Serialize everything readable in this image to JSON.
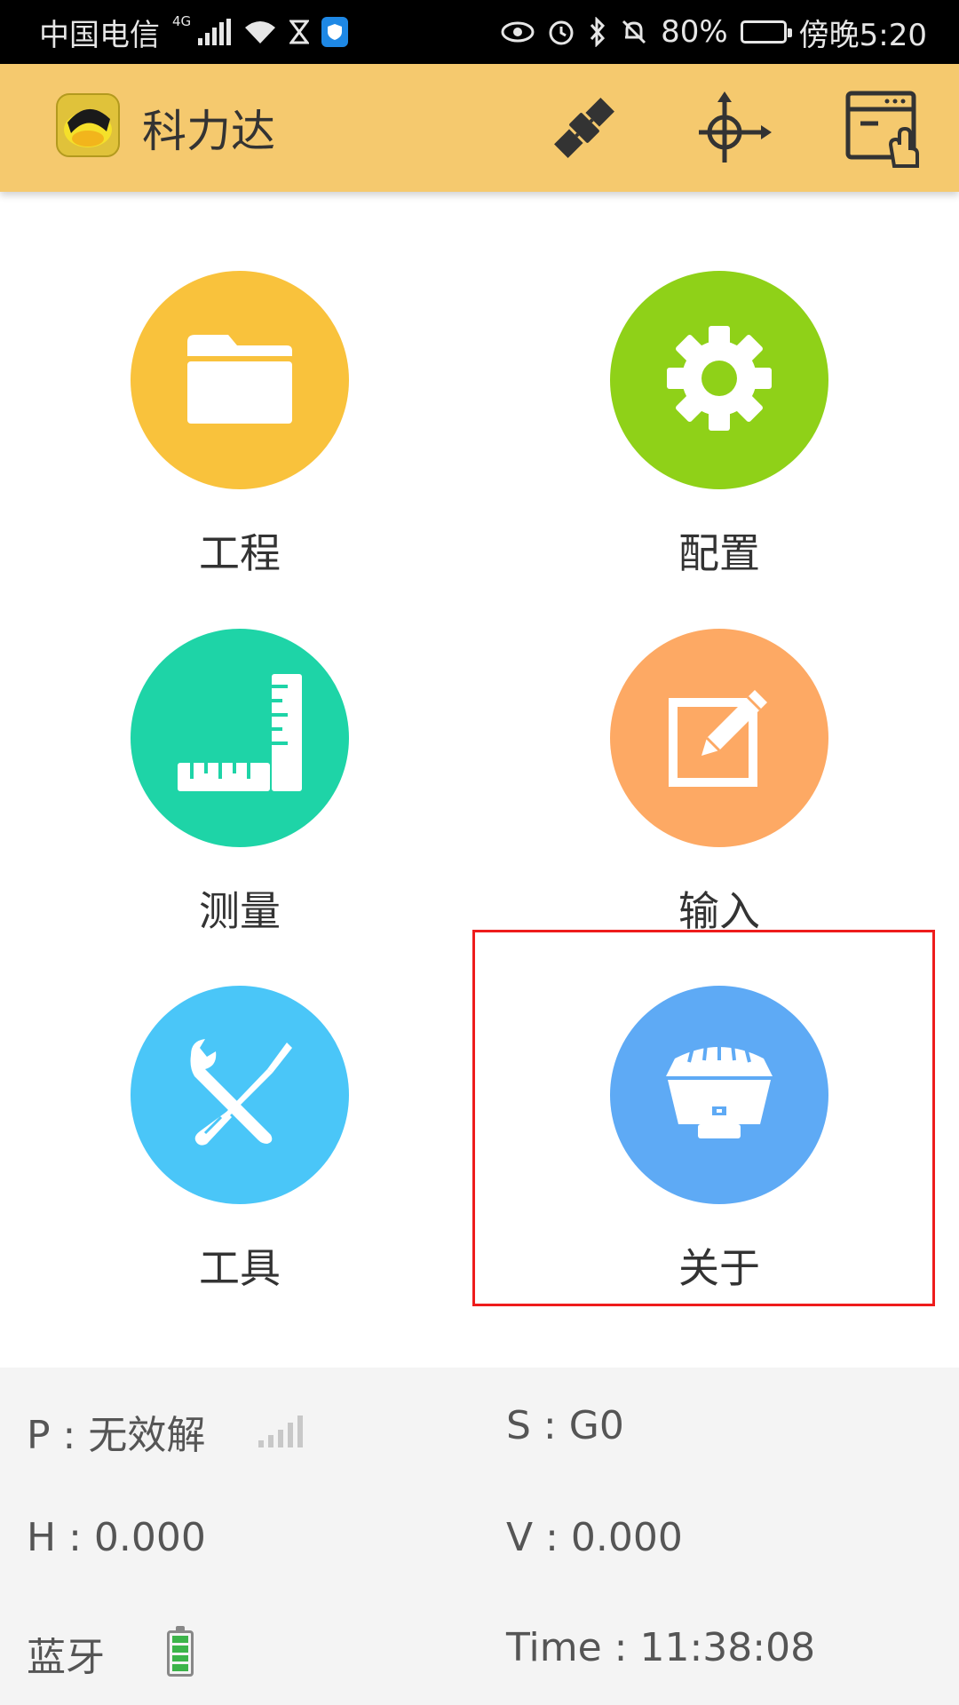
{
  "status_bar": {
    "carrier": "中国电信",
    "network": "4G",
    "battery_percent": "80%",
    "time": "傍晚5:20",
    "icons": [
      "signal-icon",
      "wifi-icon",
      "hourglass-icon",
      "shield-icon",
      "eye-icon",
      "alarm-icon",
      "bluetooth-icon",
      "mute-icon",
      "battery-icon"
    ]
  },
  "app_bar": {
    "title": "科力达",
    "actions": [
      "satellite-icon",
      "target-icon",
      "window-pointer-icon"
    ],
    "color": "#f5c96e"
  },
  "menu": {
    "items": [
      {
        "id": "project",
        "label": "工程",
        "icon": "folder-icon",
        "color": "#f9c23c"
      },
      {
        "id": "config",
        "label": "配置",
        "icon": "gear-icon",
        "color": "#8fd118"
      },
      {
        "id": "measure",
        "label": "测量",
        "icon": "ruler-icon",
        "color": "#1ed4a7"
      },
      {
        "id": "input",
        "label": "输入",
        "icon": "edit-icon",
        "color": "#fda964"
      },
      {
        "id": "tools",
        "label": "工具",
        "icon": "tools-icon",
        "color": "#4ac6f8"
      },
      {
        "id": "about",
        "label": "关于",
        "icon": "receiver-icon",
        "color": "#5eaaf5"
      }
    ],
    "highlight_color": "#ee1c1c"
  },
  "info": {
    "p": "P : 无效解",
    "s": "S : G0",
    "h": "H : 0.000",
    "v": "V : 0.000",
    "bluetooth": "蓝牙",
    "time": "Time :  11:38:08"
  }
}
